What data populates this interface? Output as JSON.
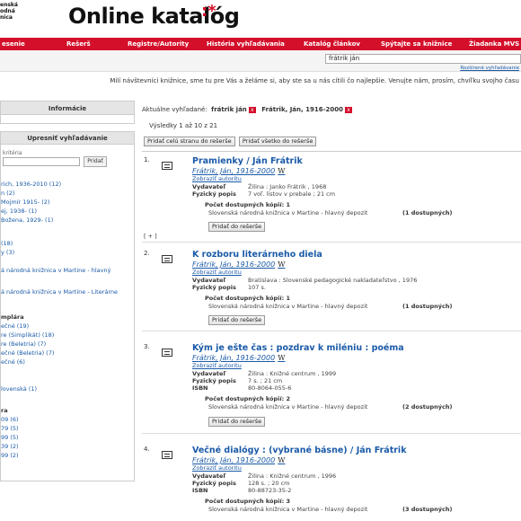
{
  "header": {
    "logo_lines": [
      "enská",
      "odná",
      "nica"
    ],
    "title": "Online katalóg",
    "star": ":*"
  },
  "nav": {
    "items": [
      "esenie",
      "Rešerš",
      "Registre/Autority",
      "História vyhľadávania",
      "Katalóg článkov",
      "Spýtajte sa knižnice",
      "Žiadanka MVS"
    ]
  },
  "search": {
    "value": "frátrik ján",
    "advanced_link": "Rozšírené vyhľadávanie"
  },
  "notice": "Milí návštevníci knižnice, sme tu pre Vás a želáme si, aby ste sa u nás cítili čo najlepšie. Venujte nám, prosím, chvíľku svojho času",
  "sidebar": {
    "info_heading": "Informácie",
    "refine_heading": "Upresniť vyhľadávanie",
    "refine_sub": "kritéria",
    "refine_button": "Pridať",
    "facets": [
      "rich, 1936-2010 (12)",
      "n (2)",
      "Mojmír 1915- (2)",
      "ej, 1938- (1)",
      "Božena, 1929- (1)",
      "(18)",
      "y (3)",
      "á národná knižnica v Martine - hlavný",
      "á národná knižnica v Martine - Literárne",
      "mplára",
      "ečné (19)",
      "re (Simplikát) (18)",
      "re (Beletria) (7)",
      "ečné (Beletria) (7)",
      "ečné (6)",
      "lovenská (1)",
      "ra",
      "09 (6)",
      "79 (5)",
      "99 (5)",
      "39 (2)",
      "99 (2)"
    ]
  },
  "main": {
    "current_label": "Aktuálne vyhľadané:",
    "current_terms": [
      "frátrik ján",
      "Frátrik, Ján, 1916-2000"
    ],
    "results_count": "Výsledky 1 až 10 z 21",
    "add_page_button": "Pridať celú stranu do rešerše",
    "add_all_button": "Pridať všetko do rešerše",
    "show_authority": "Zobraziť autoritu",
    "copies_prefix": "Počet dostupných kópií:",
    "add_button": "Pridať do rešerše",
    "plus": "[ + ]",
    "records": [
      {
        "num": "1.",
        "title": "Pramienky / Ján Frátrik",
        "author": "Frátrik, Ján, 1916-2000",
        "fields": [
          {
            "k": "Vydavateľ",
            "v": "Žilina : Janko Frátrik , 1968"
          },
          {
            "k": "Fyzický popis",
            "v": "7 voľ. listov v prebale ; 21 cm"
          }
        ],
        "copies": "1",
        "depot": "Slovenská národná knižnica v Martine - hlavný depozit",
        "avail": "(1 dostupných)"
      },
      {
        "num": "2.",
        "title": "K rozboru literárneho diela",
        "author": "Frátrik, Ján, 1916-2000",
        "fields": [
          {
            "k": "Vydavateľ",
            "v": "Bratislava : Slovenské pedagogické nakladateľstvo , 1976"
          },
          {
            "k": "Fyzický popis",
            "v": "107 s."
          }
        ],
        "copies": "1",
        "depot": "Slovenská národná knižnica v Martine - hlavný depozit",
        "avail": "(1 dostupných)"
      },
      {
        "num": "3.",
        "title": "Kým je ešte čas : pozdrav k miléniu : poéma",
        "author": "Frátrik, Ján, 1916-2000",
        "fields": [
          {
            "k": "Vydavateľ",
            "v": "Žilina : Knižné centrum , 1999"
          },
          {
            "k": "Fyzický popis",
            "v": "7 s. ; 21 cm"
          },
          {
            "k": "ISBN",
            "v": "80-8064-055-6"
          }
        ],
        "copies": "2",
        "depot": "Slovenská národná knižnica v Martine - hlavný depozit",
        "avail": "(2 dostupných)"
      },
      {
        "num": "4.",
        "title": "Večné dialógy : (vybrané básne) / Ján Frátrik",
        "author": "Frátrik, Ján, 1916-2000",
        "fields": [
          {
            "k": "Vydavateľ",
            "v": "Žilina : Knižné centrum , 1996"
          },
          {
            "k": "Fyzický popis",
            "v": "128 s. ; 20 cm"
          },
          {
            "k": "ISBN",
            "v": "80-88723-35-2"
          }
        ],
        "copies": "3",
        "depot": "Slovenská národná knižnica v Martine - hlavný depozit",
        "avail": "(3 dostupných)"
      }
    ]
  },
  "colors": {
    "brand_red": "#d40f2a",
    "link_blue": "#1a5aa8"
  }
}
